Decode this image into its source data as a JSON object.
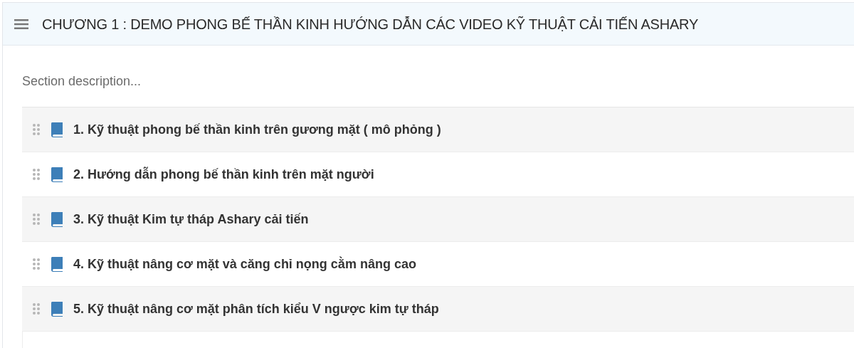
{
  "section": {
    "title": "CHƯƠNG 1 : DEMO PHONG BẾ THẦN KINH HƯỚNG DẪN CÁC VIDEO KỸ THUẬT CẢI TIẾN ASHARY",
    "description": "Section description..."
  },
  "lessons": [
    {
      "title": "1. Kỹ thuật phong bế thần kinh trên gương mặt ( mô phỏng )"
    },
    {
      "title": "2. Hướng dẫn phong bế thần kinh trên mặt người"
    },
    {
      "title": "3. Kỹ thuật Kim tự tháp Ashary cải tiến"
    },
    {
      "title": "4. Kỹ thuật nâng cơ mặt và căng chỉ nọng cằm nâng cao"
    },
    {
      "title": "5. Kỹ thuật nâng cơ mặt phân tích kiểu V ngược kim tự tháp"
    }
  ]
}
